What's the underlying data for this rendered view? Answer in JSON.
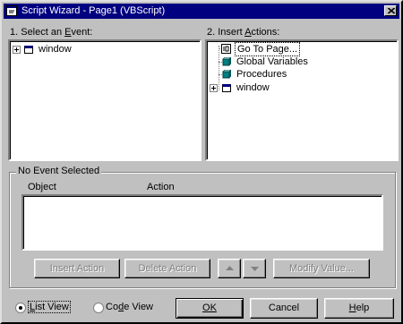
{
  "window": {
    "title": "Script Wizard - Page1 (VBScript)"
  },
  "events": {
    "label_before": "1. Select an ",
    "label_access": "E",
    "label_after": "vent:",
    "items": [
      {
        "label": "window"
      }
    ]
  },
  "actions": {
    "label_before": "2. Insert ",
    "label_access": "A",
    "label_after": "ctions:",
    "items": [
      {
        "label": "Go To Page..."
      },
      {
        "label": "Global Variables"
      },
      {
        "label": "Procedures"
      },
      {
        "label": "window"
      }
    ]
  },
  "group": {
    "title": "No Event Selected",
    "col_object": "Object",
    "col_action": "Action",
    "buttons": {
      "insert_action": "Insert Action",
      "delete_action": "Delete Action",
      "modify_value": "Modify Value..."
    }
  },
  "view": {
    "list_view": {
      "before": "",
      "access": "L",
      "after": "ist View",
      "selected": true
    },
    "code_view": {
      "before": "Co",
      "access": "d",
      "after": "e View",
      "selected": false
    }
  },
  "footer": {
    "ok": "OK",
    "cancel": "Cancel",
    "help_access": "H",
    "help_after": "elp"
  }
}
